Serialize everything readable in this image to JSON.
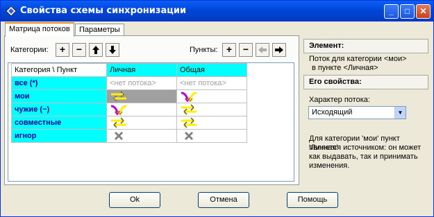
{
  "window": {
    "title": "Свойства схемы синхронизации"
  },
  "tabs": [
    {
      "label": "Матрица потоков",
      "active": true
    },
    {
      "label": "Параметры",
      "active": false
    }
  ],
  "toolbar": {
    "categories_label": "Категории:",
    "points_label": "Пункты:",
    "add": "+",
    "remove": "−",
    "up": "🡅",
    "down": "🡇",
    "left": "←",
    "right": "→"
  },
  "matrix": {
    "corner": "Категория \\ Пункт",
    "columns": [
      "Личная",
      "Общая"
    ],
    "rows": [
      {
        "label": "все (*)",
        "cells": [
          "<нет потока>",
          "<нет потока>"
        ]
      },
      {
        "label": "мои",
        "cells": [
          "sync-both",
          "sync-in"
        ]
      },
      {
        "label": "чужие (~)",
        "cells": [
          "sync-in",
          "sync-both"
        ]
      },
      {
        "label": "совместные",
        "cells": [
          "sync-both",
          "sync-both"
        ]
      },
      {
        "label": "игнор",
        "cells": [
          "ignore",
          "ignore"
        ]
      }
    ],
    "selected": {
      "row": 1,
      "col": 0
    }
  },
  "element_section": {
    "header": "Элемент:",
    "line1": "Поток для категории <мои>",
    "line2": "в пункте <Личная>"
  },
  "props_section": {
    "header": "Его свойства:",
    "type_label": "Характер потока:",
    "type_value": "Исходящий",
    "description": [
      "Для категории 'мои' пункт 'Личная'",
      "является источником: он может",
      "как выдавать, так и принимать",
      "изменения."
    ]
  },
  "buttons": {
    "ok": "Ok",
    "cancel": "Отмена",
    "help": "Помощь"
  },
  "colors": {
    "accent": "#00ffff",
    "title": "#0a5ef7"
  }
}
